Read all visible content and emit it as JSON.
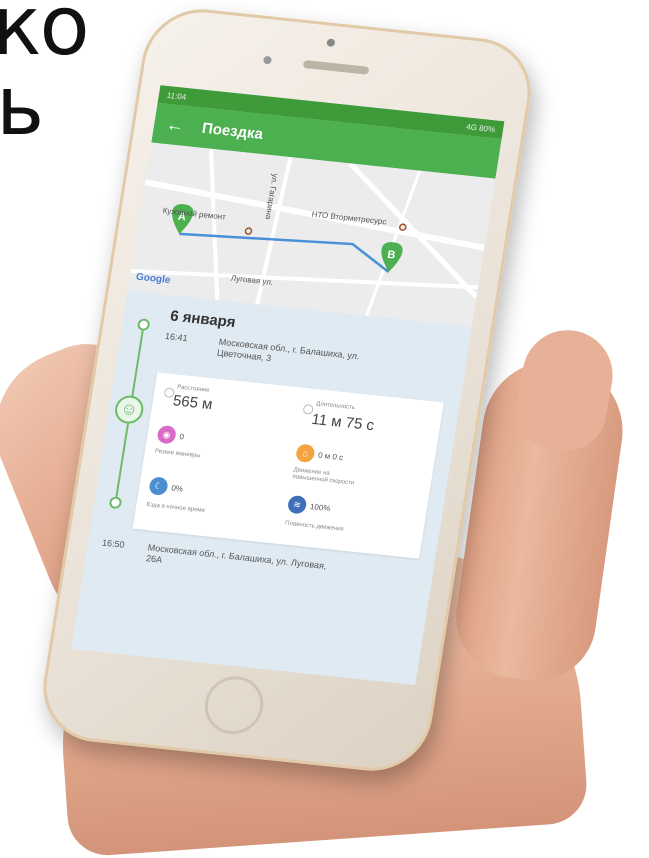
{
  "background_text": [
    "ко",
    "ь"
  ],
  "status_bar": {
    "left": "11:04",
    "right": "4G 80%"
  },
  "appbar": {
    "title": "Поездка"
  },
  "map": {
    "poi_left": "Кузовной ремонт",
    "poi_right": "НТО Вторметресурс",
    "street_vertical": "ул. Гагарина",
    "street_bottom": "Луговая ул.",
    "marker_a": "A",
    "marker_b": "B",
    "google": "Google",
    "route_color": "#4a90d9"
  },
  "trip": {
    "date": "6 января",
    "start": {
      "time": "16:41",
      "address": "Московская обл., г. Балашиха, ул. Цветочная, 3"
    },
    "end": {
      "time": "16:50",
      "address": "Московская обл., г. Балашиха, ул. Луговая, 26А"
    }
  },
  "stats": {
    "distance_label": "Расстояние",
    "distance_value": "565 м",
    "duration_label": "Длительность",
    "duration_value": "11 м 75 с",
    "sharp_label": "Резкие маневры",
    "sharp_value": "0",
    "motorway_label": "Движение на повышенной скорости",
    "motorway_value": "0 м 0 с",
    "night_label": "Езда в ночное время",
    "night_value": "0%",
    "smooth_label": "Плавность движения",
    "smooth_value": "100%"
  },
  "colors": {
    "accent": "#4caf50",
    "pink": "#d86bc7",
    "orange": "#f4a340",
    "blue": "#4c8fd1"
  }
}
